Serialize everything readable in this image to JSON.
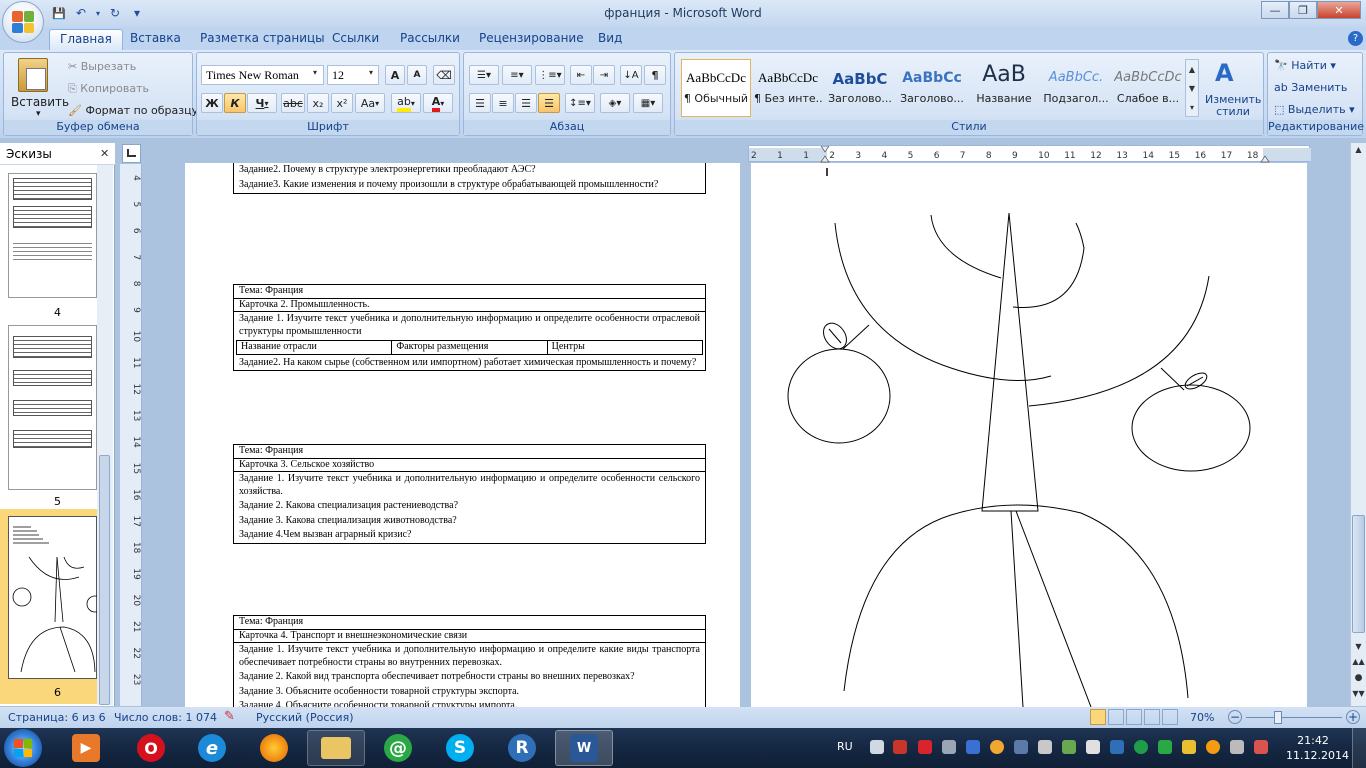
{
  "window": {
    "title": "франция - Microsoft Word",
    "controls": {
      "minimize": "—",
      "maximize": "❐",
      "close": "✕"
    }
  },
  "quick_access": {
    "save": "💾",
    "undo": "↶",
    "redo": "↻",
    "customize": "▾"
  },
  "tabs": [
    "Главная",
    "Вставка",
    "Разметка страницы",
    "Ссылки",
    "Рассылки",
    "Рецензирование",
    "Вид"
  ],
  "active_tab": "Главная",
  "clipboard": {
    "label": "Буфер обмена",
    "paste": "Вставить",
    "cut": "Вырезать",
    "copy": "Копировать",
    "format_painter": "Формат по образцу"
  },
  "font": {
    "label": "Шрифт",
    "family": "Times New Roman",
    "size": "12",
    "bold": "Ж",
    "italic": "К",
    "underline": "Ч",
    "strike": "abc",
    "subscript": "x₂",
    "superscript": "x²",
    "case": "Aa",
    "grow": "A",
    "shrink": "A"
  },
  "paragraph": {
    "label": "Абзац",
    "pilcrow": "¶"
  },
  "styles": {
    "label": "Стили",
    "items": [
      {
        "sample": "AaBbCcDc",
        "name": "¶ Обычный"
      },
      {
        "sample": "AaBbCcDc",
        "name": "¶ Без инте..."
      },
      {
        "sample": "AaBbC",
        "name": "Заголово..."
      },
      {
        "sample": "AaBbCc",
        "name": "Заголово..."
      },
      {
        "sample": "AaB",
        "name": "Название"
      },
      {
        "sample": "AaBbCc.",
        "name": "Подзагол..."
      },
      {
        "sample": "AaBbCcDc",
        "name": "Слабое в..."
      }
    ],
    "change_styles": "Изменить стили"
  },
  "editing": {
    "label": "Редактирование",
    "find": "Найти",
    "replace": "Заменить",
    "select": "Выделить"
  },
  "thumbnails": {
    "header": "Эскизы",
    "pages": [
      "4",
      "5",
      "6"
    ]
  },
  "hruler": {
    "marks": [
      "2",
      "1",
      "1",
      "2",
      "3",
      "4",
      "5",
      "6",
      "7",
      "8",
      "9",
      "10",
      "11",
      "12",
      "13",
      "14",
      "15",
      "16",
      "17",
      "18"
    ]
  },
  "vruler": {
    "marks": [
      "4",
      "5",
      "6",
      "7",
      "8",
      "9",
      "10",
      "11",
      "12",
      "13",
      "14",
      "15",
      "16",
      "17",
      "18",
      "19",
      "20",
      "21",
      "22",
      "23"
    ]
  },
  "document": {
    "card1_tail": [
      "Задание2. Почему в структуре электроэнергетики преобладают АЭС?",
      "Задание3. Какие изменения и почему произошли в структуре обрабатывающей промышленности?"
    ],
    "card2": {
      "topic": "Тема: Франция",
      "title": "Карточка 2. Промышленность.",
      "task1": "Задание 1. Изучите текст учебника и дополнительную информацию и определите особенности отраслевой структуры промышленности",
      "cols": [
        "Название отрасли",
        "Факторы размещения",
        "Центры"
      ],
      "task2": "Задание2. На каком сырье (собственном или импортном) работает химическая промышленность и почему?"
    },
    "card3": {
      "topic": "Тема: Франция",
      "title": "Карточка 3. Сельское хозяйство",
      "tasks": [
        "Задание 1. Изучите текст учебника и дополнительную информацию и определите особенности сельского хозяйства.",
        "Задание 2. Какова специализация растениеводства?",
        "Задание 3. Какова специализация животноводства?",
        "Задание 4.Чем вызван аграрный кризис?"
      ]
    },
    "card4": {
      "topic": "Тема: Франция",
      "title": "Карточка 4. Транспорт и внешнеэкономические связи",
      "tasks": [
        "Задание 1. Изучите текст учебника и дополнительную информацию и определите какие виды транспорта обеспечивает потребности страны во внутренних перевозках.",
        "Задание 2. Какой вид транспорта обеспечивает потребности страны во внешних перевозках?",
        "Задание 3. Объясните особенности товарной структуры экспорта.",
        "Задание 4. Объясните особенности товарной структуры импорта."
      ]
    }
  },
  "status": {
    "page": "Страница: 6 из 6",
    "words": "Число слов: 1 074",
    "language": "Русский (Россия)",
    "zoom": "70%"
  },
  "taskbar": {
    "lang": "RU",
    "time": "21:42",
    "date": "11.12.2014"
  },
  "colors": {
    "accent": "#15428b",
    "ribbon": "#c9dbf2",
    "workspace": "#abc3df",
    "taskbar": "#152742"
  }
}
